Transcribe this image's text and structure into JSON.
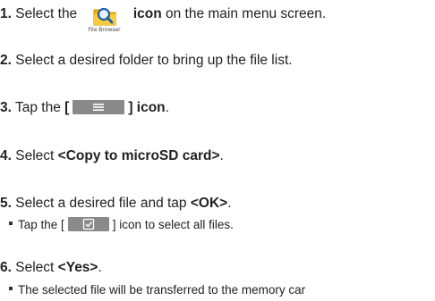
{
  "steps": [
    {
      "number": "1.",
      "pre": "Select the",
      "icon_name": "file-browser-icon",
      "icon_caption": "File Browser",
      "bold": "icon",
      "post": "on the main menu screen."
    },
    {
      "number": "2.",
      "text": "Select a desired folder to bring up the file list."
    },
    {
      "number": "3.",
      "pre": "Tap the",
      "bold_open": "[",
      "icon_name": "menu-icon",
      "bold_close": "] icon",
      "post": "."
    },
    {
      "number": "4.",
      "pre": "Select",
      "bold": "<Copy to microSD card>",
      "post": "."
    },
    {
      "number": "5.",
      "pre": "Select a desired file and tap",
      "bold": "<OK>",
      "post": ".",
      "sub": {
        "pre": "Tap the [",
        "icon_name": "select-all-checkbox-icon",
        "post": "] icon to select all files."
      }
    },
    {
      "number": "6.",
      "pre": "Select",
      "bold": "<Yes>",
      "post": ".",
      "sub": {
        "text": "The selected file will be transferred to the memory car"
      }
    }
  ],
  "colors": {
    "text": "#222222",
    "chip": "#8a8a8a",
    "folder": "#f2b705",
    "magnifier": "#1f5fa8"
  }
}
